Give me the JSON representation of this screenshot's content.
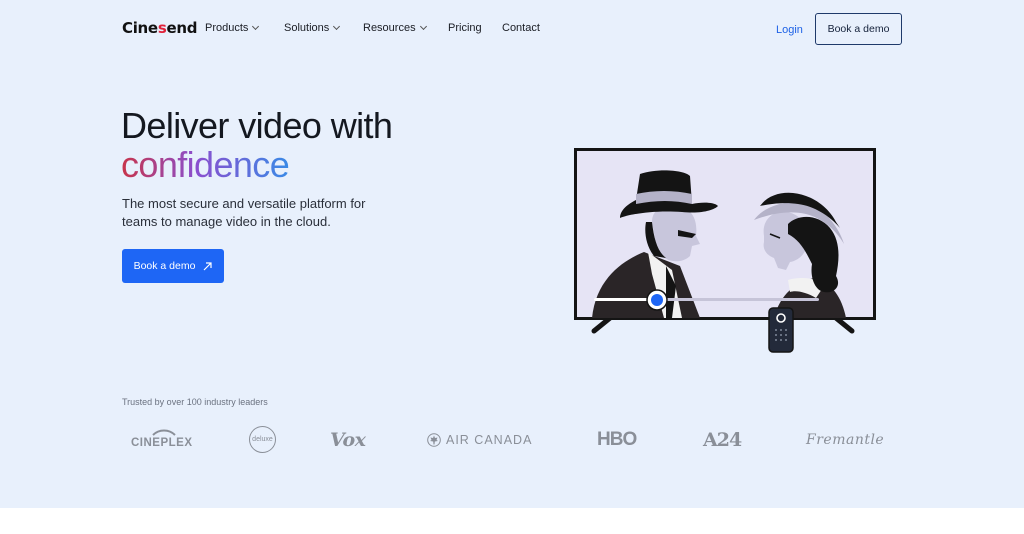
{
  "nav": {
    "logo_prefix": "Cine",
    "logo_accent": "s",
    "logo_suffix": "end",
    "items": [
      {
        "label": "Products"
      },
      {
        "label": "Solutions"
      },
      {
        "label": "Resources"
      },
      {
        "label": "Pricing"
      },
      {
        "label": "Contact"
      }
    ],
    "login_label": "Login",
    "book_demo_label": "Book a demo"
  },
  "hero": {
    "headline_line1": "Deliver video with",
    "headline_line2": "confidence",
    "subtext": "The most secure and versatile platform for teams to manage video in the cloud.",
    "cta_label": "Book a demo"
  },
  "trusted": {
    "label": "Trusted by over 100 industry leaders",
    "brands": [
      "CINEPLEX",
      "deluxe",
      "Vox",
      "AIR CANADA",
      "HBO",
      "A24",
      "Fremantle"
    ]
  },
  "colors": {
    "background": "#e8f0fc",
    "primary": "#1e66f5",
    "brand_red": "#e0223a",
    "text": "#141820"
  },
  "icons": {
    "cta_icon": "arrow-up-right-icon",
    "nav_chevron": "chevron-down-icon"
  }
}
